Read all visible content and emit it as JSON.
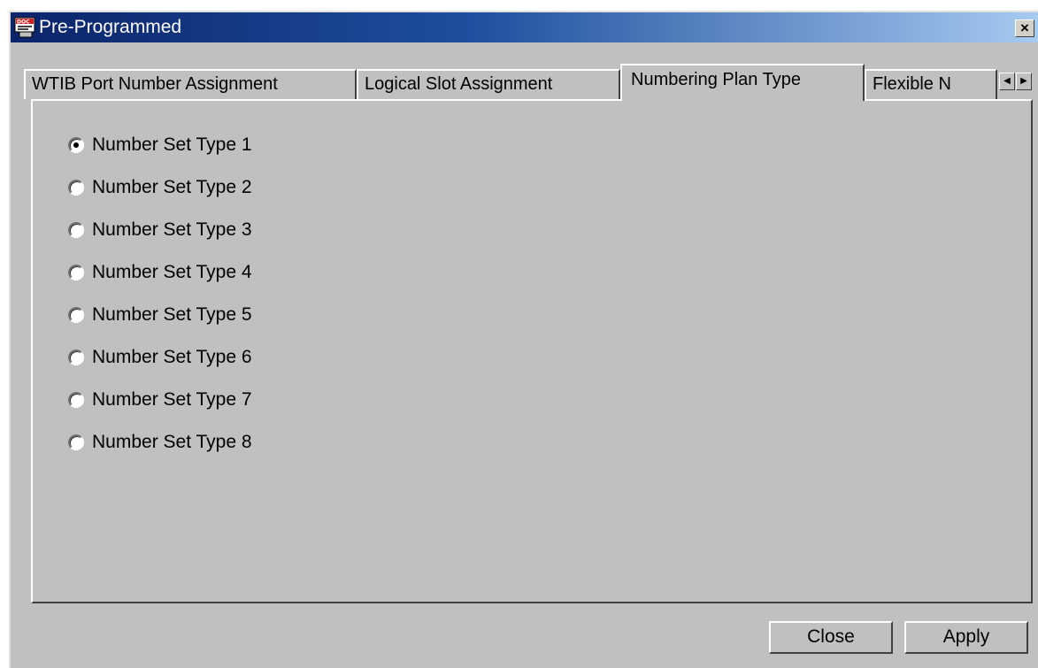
{
  "window": {
    "title": "Pre-Programmed",
    "close_glyph": "×",
    "icon": "app-doc-icon"
  },
  "tabs": [
    {
      "label": "WTIB Port Number Assignment",
      "active": false
    },
    {
      "label": "Logical Slot Assignment",
      "active": false
    },
    {
      "label": "Numbering Plan Type",
      "active": true
    },
    {
      "label": "Flexible N",
      "active": false
    }
  ],
  "tab_scroll": {
    "left_glyph": "◀",
    "right_glyph": "▶"
  },
  "radio_options": [
    {
      "label": "Number Set Type 1",
      "selected": true
    },
    {
      "label": "Number Set Type 2",
      "selected": false
    },
    {
      "label": "Number Set Type 3",
      "selected": false
    },
    {
      "label": "Number Set Type 4",
      "selected": false
    },
    {
      "label": "Number Set Type 5",
      "selected": false
    },
    {
      "label": "Number Set Type 6",
      "selected": false
    },
    {
      "label": "Number Set Type 7",
      "selected": false
    },
    {
      "label": "Number Set Type 8",
      "selected": false
    }
  ],
  "buttons": {
    "close_label": "Close",
    "apply_label": "Apply"
  }
}
